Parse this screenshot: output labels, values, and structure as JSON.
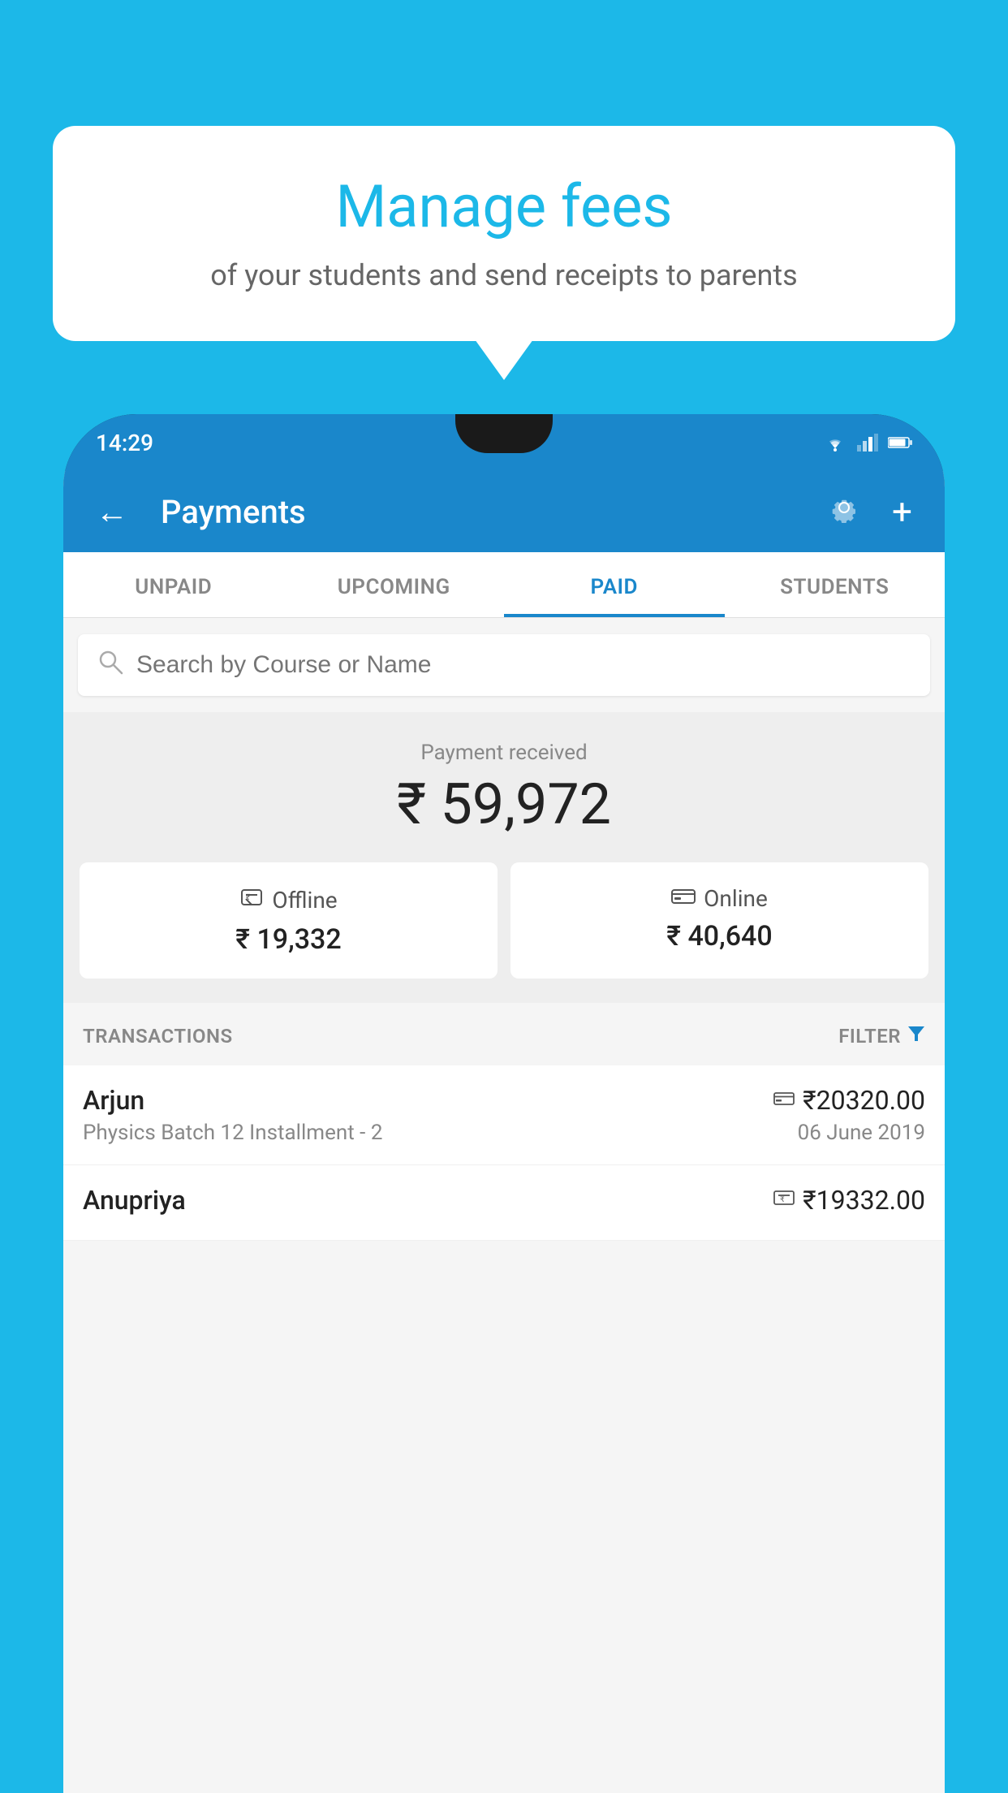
{
  "background_color": "#1cb8e8",
  "tooltip": {
    "title": "Manage fees",
    "subtitle": "of your students and send receipts to parents"
  },
  "status_bar": {
    "time": "14:29",
    "wifi": "▾",
    "signal": "◂",
    "battery": "▮"
  },
  "toolbar": {
    "title": "Payments",
    "back_icon": "←",
    "gear_icon": "⚙",
    "plus_icon": "+"
  },
  "tabs": [
    {
      "label": "UNPAID",
      "active": false
    },
    {
      "label": "UPCOMING",
      "active": false
    },
    {
      "label": "PAID",
      "active": true
    },
    {
      "label": "STUDENTS",
      "active": false
    }
  ],
  "search": {
    "placeholder": "Search by Course or Name"
  },
  "payment_summary": {
    "label": "Payment received",
    "amount": "₹ 59,972",
    "offline_label": "Offline",
    "offline_amount": "₹ 19,332",
    "online_label": "Online",
    "online_amount": "₹ 40,640"
  },
  "transactions_header": {
    "label": "TRANSACTIONS",
    "filter_label": "FILTER"
  },
  "transactions": [
    {
      "name": "Arjun",
      "amount": "₹20320.00",
      "description": "Physics Batch 12 Installment - 2",
      "date": "06 June 2019",
      "icon_type": "card"
    },
    {
      "name": "Anupriya",
      "amount": "₹19332.00",
      "description": "",
      "date": "",
      "icon_type": "cash"
    }
  ]
}
